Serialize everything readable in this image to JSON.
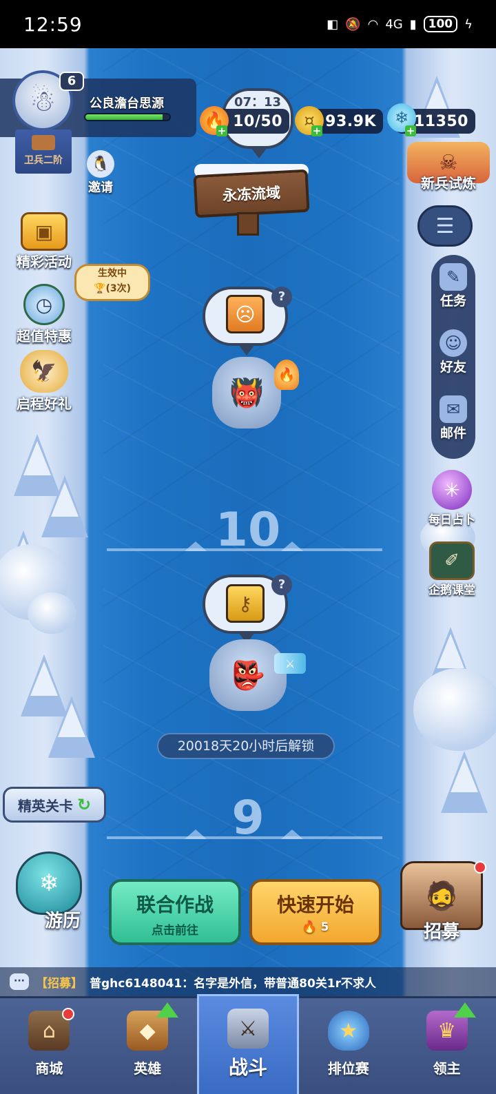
{
  "status_bar": {
    "time": "12:59",
    "network": "4G",
    "battery": "100"
  },
  "player": {
    "name": "公良澹台思源",
    "level": "6",
    "rank": "卫兵二阶",
    "xp_progress": 0.92
  },
  "resources": {
    "timer": "07：13",
    "stamina": "10/50",
    "gold": "93.9K",
    "gems": "11350"
  },
  "zone_title": "永冻流域",
  "left_menu": {
    "invite": "邀请",
    "events": "精彩活动",
    "deals": "超值特惠",
    "deals_effect": "生效中",
    "deals_count": "(3次)",
    "starter_gift": "启程好礼"
  },
  "right_menu": {
    "trial": "新兵试炼",
    "tasks": "任务",
    "friends": "好友",
    "mail": "邮件",
    "daily_fortune": "每日占卜",
    "penguin_class": "企鹅课堂"
  },
  "stages": [
    {
      "number": "10"
    },
    {
      "number": "9"
    }
  ],
  "unlock_text": "20018天20小时后解锁",
  "elite_stage": "精英关卡",
  "coop_battle": {
    "title": "联合作战",
    "subtitle": "点击前往"
  },
  "quick_start": {
    "title": "快速开始",
    "cost": "5"
  },
  "travel": "游历",
  "recruit": "招募",
  "chat": {
    "tag": "【招募】",
    "message": "普ghc6148041：名字是外信，带普通80关1r不求人"
  },
  "bottom_nav": [
    {
      "label": "商城"
    },
    {
      "label": "英雄"
    },
    {
      "label": "战斗"
    },
    {
      "label": "排位赛"
    },
    {
      "label": "领主"
    }
  ],
  "colors": {
    "river": "#1e73c4",
    "snow": "#dbe7f8",
    "coop_green": "#31bf93",
    "quick_orange": "#f3a72e",
    "nav_bg": "#4c6396"
  }
}
